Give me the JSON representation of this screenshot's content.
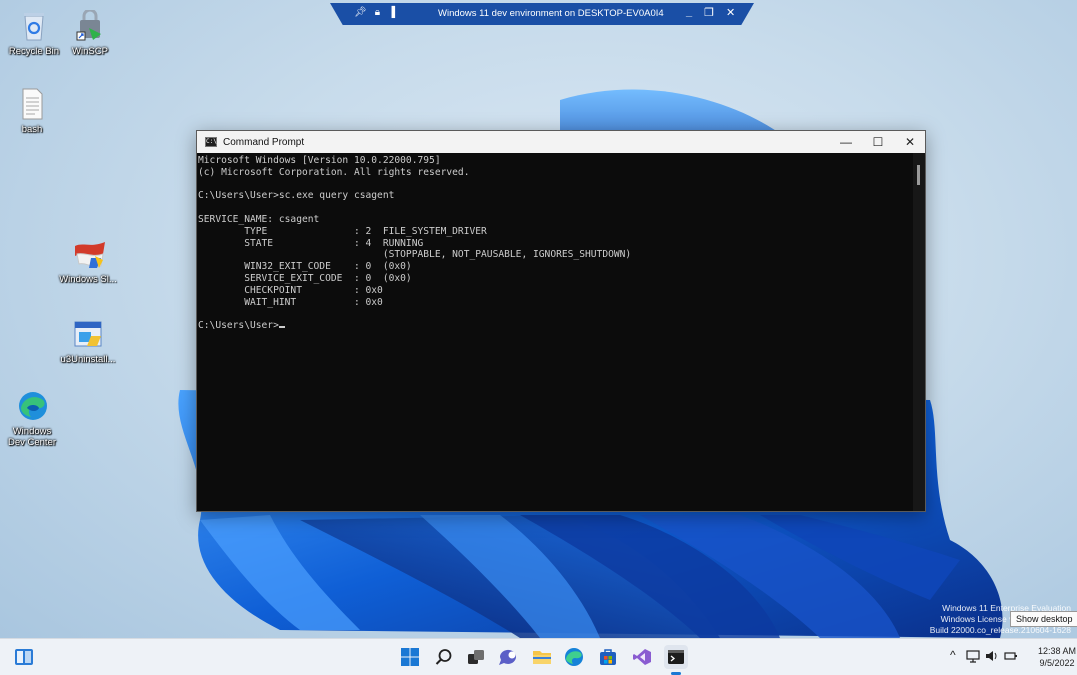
{
  "remote_bar": {
    "title": "Windows 11 dev environment on DESKTOP-EV0A0I4",
    "left_icons": [
      "pin-icon",
      "lock-icon",
      "signal-icon"
    ],
    "min_label": "_",
    "restore_label": "❐",
    "close_label": "✕"
  },
  "desktop_icons": [
    {
      "label": "Recycle Bin",
      "icon": "recycle-bin-icon"
    },
    {
      "label": "WinSCP",
      "icon": "winscp-icon"
    },
    {
      "label": "bash",
      "icon": "text-file-icon"
    },
    {
      "label": "Windows Sl...",
      "icon": "windows-sl-icon"
    },
    {
      "label": "u3Uninstall...",
      "icon": "installer-icon"
    },
    {
      "label": "Windows Dev Center",
      "icon": "edge-icon"
    }
  ],
  "cmd": {
    "title": "Command Prompt",
    "app_icon_text": "C:\\",
    "minimize": "—",
    "maximize": "☐",
    "close": "✕",
    "lines": [
      "Microsoft Windows [Version 10.0.22000.795]",
      "(c) Microsoft Corporation. All rights reserved.",
      "",
      "C:\\Users\\User>sc.exe query csagent",
      "",
      "SERVICE_NAME: csagent",
      "        TYPE               : 2  FILE_SYSTEM_DRIVER",
      "        STATE              : 4  RUNNING",
      "                                (STOPPABLE, NOT_PAUSABLE, IGNORES_SHUTDOWN)",
      "        WIN32_EXIT_CODE    : 0  (0x0)",
      "        SERVICE_EXIT_CODE  : 0  (0x0)",
      "        CHECKPOINT         : 0x0",
      "        WAIT_HINT          : 0x0",
      "",
      "C:\\Users\\User>"
    ]
  },
  "watermark": {
    "line1": "Windows 11 Enterprise Evaluation",
    "line2": "Windows License valid for 90 days",
    "line3": "Build 22000.co_release.210604-1628"
  },
  "tooltip": "Show desktop",
  "taskbar": {
    "widgets_icon": "widgets-icon",
    "pinned": [
      "start-icon",
      "search-icon",
      "task-view-icon",
      "chat-icon",
      "file-explorer-icon",
      "edge-icon",
      "store-icon",
      "visual-studio-icon",
      "terminal-icon"
    ],
    "tray": {
      "chevron": "^",
      "time": "12:38 AM",
      "date": "9/5/2022"
    }
  },
  "colors": {
    "accent": "#0067c0",
    "console_bg": "#0c0c0c",
    "console_fg": "#cccccc",
    "rdp_bar": "#1a4fa6"
  }
}
